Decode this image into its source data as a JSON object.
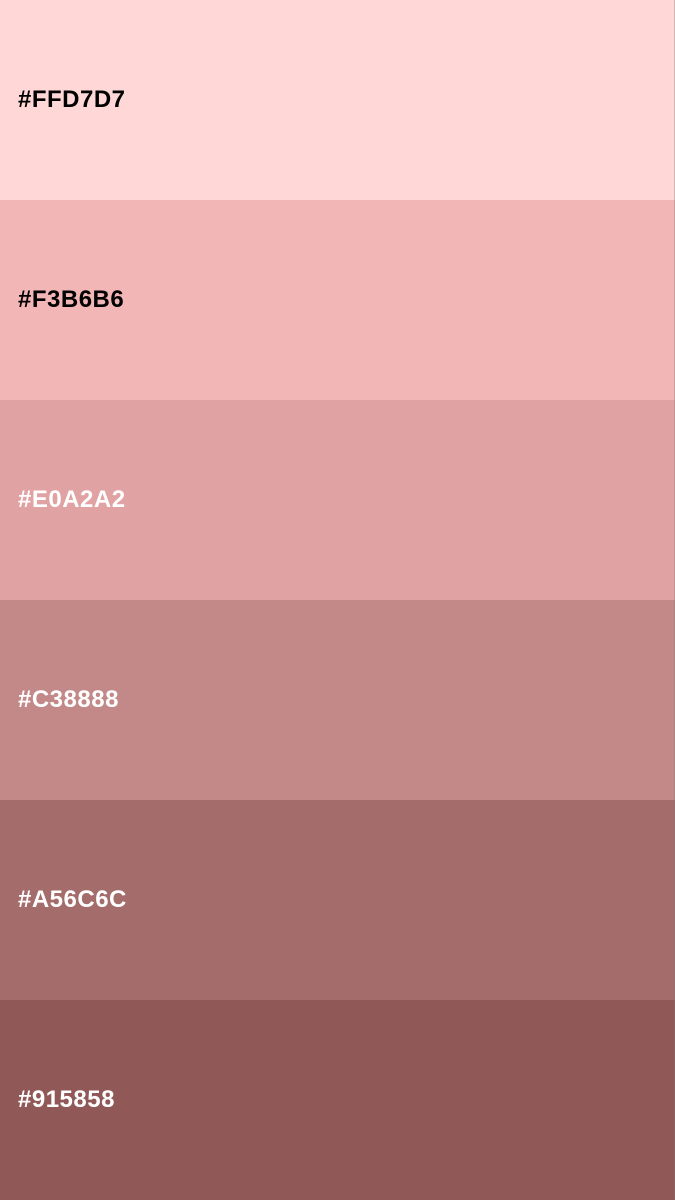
{
  "swatches": [
    {
      "hex": "#FFD7D7",
      "color": "#FFD7D7",
      "text_color": "#000000"
    },
    {
      "hex": "#F3B6B6",
      "color": "#F3B6B6",
      "text_color": "#000000"
    },
    {
      "hex": "#E0A2A2",
      "color": "#E0A2A2",
      "text_color": "#FFFFFF"
    },
    {
      "hex": "#C38888",
      "color": "#C38888",
      "text_color": "#FFFFFF"
    },
    {
      "hex": "#A56C6C",
      "color": "#A56C6C",
      "text_color": "#FFFFFF"
    },
    {
      "hex": "#915858",
      "color": "#915858",
      "text_color": "#FFFFFF"
    }
  ]
}
